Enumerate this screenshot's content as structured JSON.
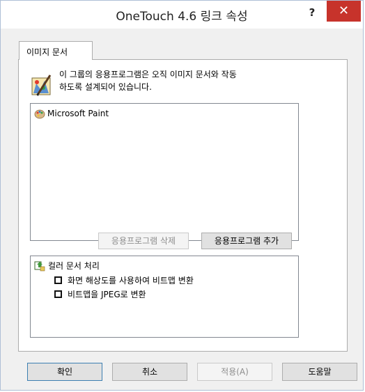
{
  "window": {
    "title": "OneTouch 4.6 링크 속성",
    "help_label": "?",
    "close_label": "✕"
  },
  "tab": {
    "label": "이미지 문서"
  },
  "description": {
    "line1": "이 그룹의 응용프로그램은 오직 이미지 문서와 작동",
    "line2": "하도록 설계되어 있습니다.",
    "icon": "paint-palette-icon"
  },
  "apps": [
    {
      "label": "Microsoft Paint",
      "icon": "palette-icon"
    }
  ],
  "app_buttons": {
    "remove_label": "응용프로그램 삭제",
    "add_label": "응용프로그램 추가"
  },
  "options": {
    "heading": "컬러 문서 처리",
    "heading_icon": "document-tree-icon",
    "items": [
      {
        "label": "화면 해상도를 사용하여 비트맵 변환",
        "checked": false
      },
      {
        "label": "비트맵을 JPEG로 변환",
        "checked": false
      }
    ]
  },
  "footer": {
    "ok_label": "확인",
    "cancel_label": "취소",
    "apply_label": "적용(A)",
    "help_label": "도움말"
  },
  "colors": {
    "close_bg": "#c7332b",
    "accent_border": "#3c7fb1"
  }
}
